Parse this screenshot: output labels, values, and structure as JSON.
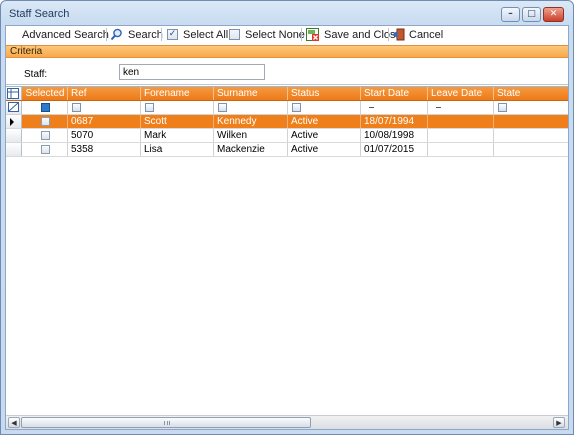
{
  "window": {
    "title": "Staff Search"
  },
  "toolbar": {
    "advanced_search": "Advanced Search",
    "search": "Search",
    "select_all": "Select All",
    "select_none": "Select None",
    "save_and_close": "Save and Close",
    "cancel": "Cancel"
  },
  "criteria": {
    "title": "Criteria",
    "staff_label": "Staff:",
    "staff_value": "ken"
  },
  "grid": {
    "columns": [
      "Selected",
      "Ref",
      "Forename",
      "Surname",
      "Status",
      "Start Date",
      "Leave Date",
      "State"
    ],
    "rows": [
      {
        "ref": "0687",
        "forename": "Scott",
        "surname": "Kennedy",
        "status": "Active",
        "start_date": "18/07/1994",
        "leave_date": "",
        "state": ""
      },
      {
        "ref": "5070",
        "forename": "Mark",
        "surname": "Wilken",
        "status": "Active",
        "start_date": "10/08/1998",
        "leave_date": "",
        "state": ""
      },
      {
        "ref": "5358",
        "forename": "Lisa",
        "surname": "Mackenzie",
        "status": "Active",
        "start_date": "01/07/2015",
        "leave_date": "",
        "state": ""
      }
    ]
  },
  "colors": {
    "accent": "#ef7f1a",
    "header": "#f59a3e",
    "frame": "#c9dcf1"
  }
}
